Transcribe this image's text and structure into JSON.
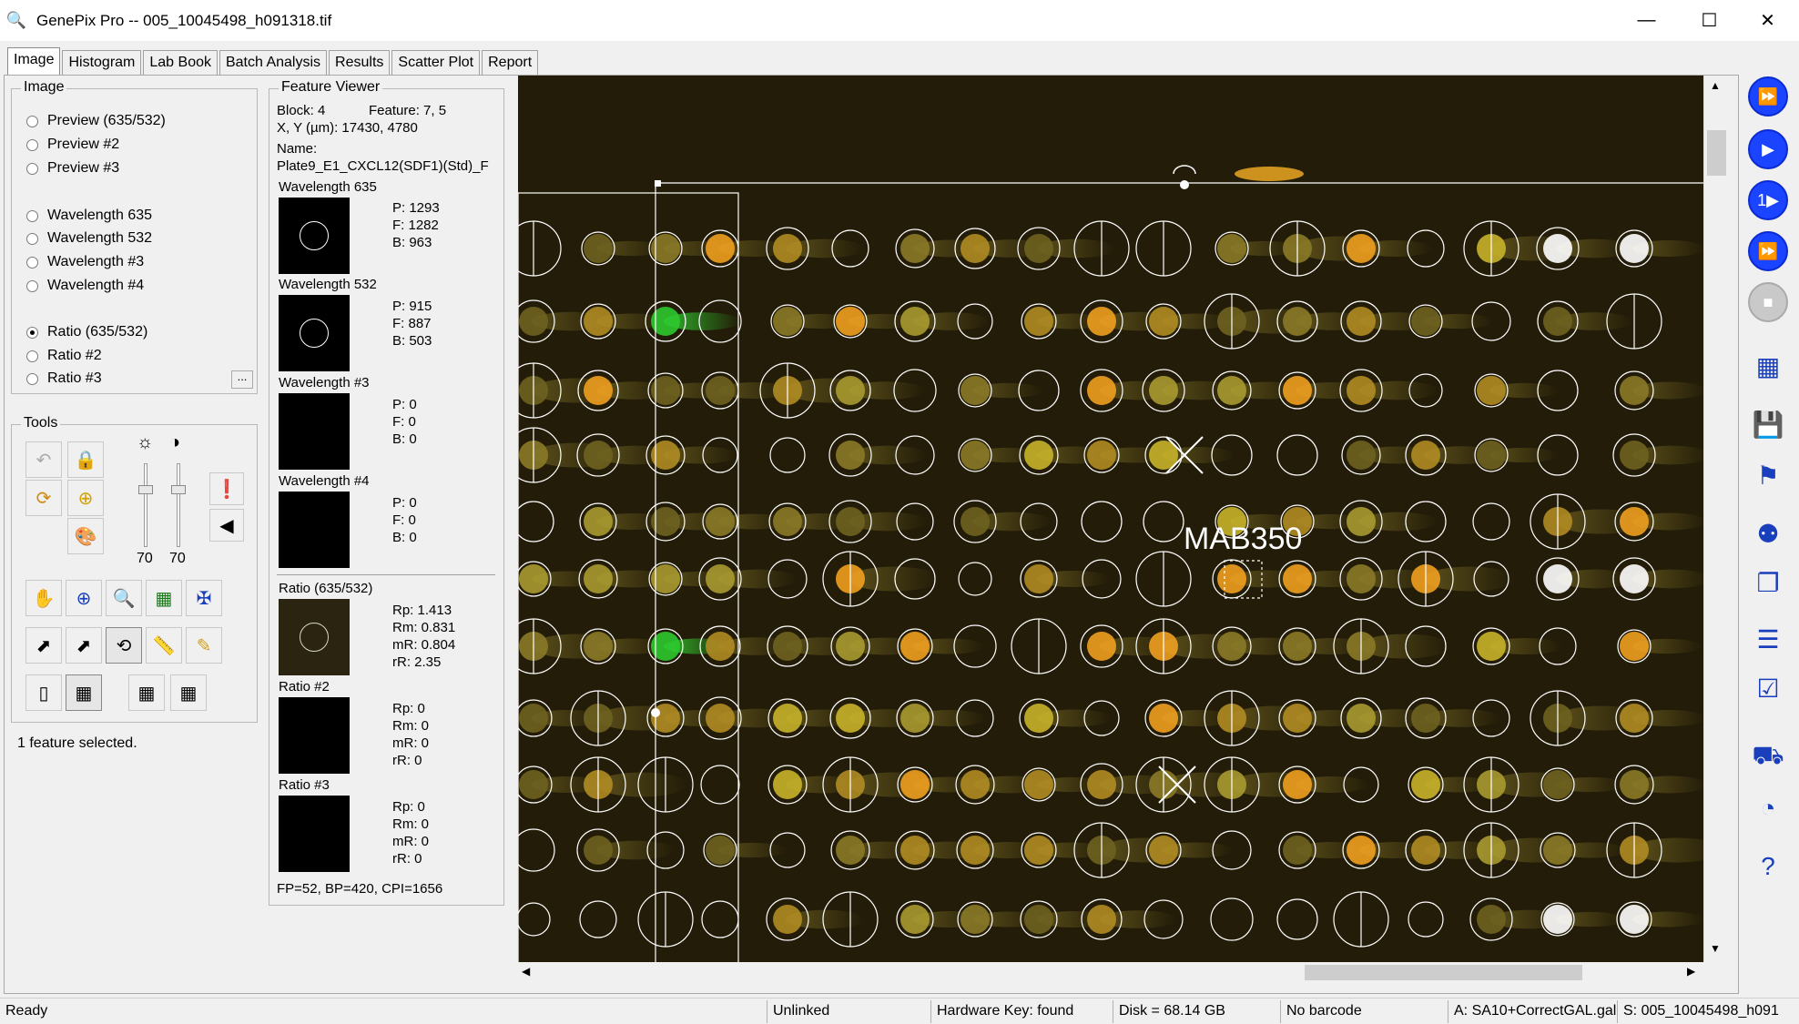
{
  "window": {
    "title": "GenePix Pro -- 005_10045498_h091318.tif",
    "app_icon": "magnifier-icon",
    "minimize_glyph": "—",
    "maximize_glyph": "☐",
    "close_glyph": "✕"
  },
  "tabs": [
    {
      "label": "Image",
      "active": true
    },
    {
      "label": "Histogram",
      "active": false
    },
    {
      "label": "Lab Book",
      "active": false
    },
    {
      "label": "Batch Analysis",
      "active": false
    },
    {
      "label": "Results",
      "active": false
    },
    {
      "label": "Scatter Plot",
      "active": false
    },
    {
      "label": "Report",
      "active": false
    }
  ],
  "image_group": {
    "title": "Image",
    "options": [
      {
        "label": "Preview (635/532)",
        "checked": false
      },
      {
        "label": "Preview #2",
        "checked": false
      },
      {
        "label": "Preview #3",
        "checked": false
      },
      {
        "label": "Wavelength 635",
        "checked": false
      },
      {
        "label": "Wavelength 532",
        "checked": false
      },
      {
        "label": "Wavelength #3",
        "checked": false
      },
      {
        "label": "Wavelength #4",
        "checked": false
      },
      {
        "label": "Ratio (635/532)",
        "checked": true
      },
      {
        "label": "Ratio #2",
        "checked": false
      },
      {
        "label": "Ratio #3",
        "checked": false
      }
    ],
    "more_button": "..."
  },
  "tools_group": {
    "title": "Tools",
    "brightness_value": "70",
    "contrast_value": "70",
    "brightness_icon": "☼",
    "contrast_icon": "◑",
    "selection_status": "1 feature selected."
  },
  "feature_viewer": {
    "title": "Feature Viewer",
    "block_label": "Block: 4",
    "feature_label": "Feature:  7, 5",
    "xy_label": "X, Y (µm): 17430, 4780",
    "name_label": "Name:",
    "name_value": "Plate9_E1_CXCL12(SDF1)(Std)_F",
    "wavelengths": [
      {
        "title": "Wavelength 635",
        "P": "P:    1293",
        "F": "F:    1282",
        "B": "B:    963",
        "ring": true
      },
      {
        "title": "Wavelength 532",
        "P": "P:    915",
        "F": "F:    887",
        "B": "B:    503",
        "ring": true
      },
      {
        "title": "Wavelength #3",
        "P": "P:    0",
        "F": "F:    0",
        "B": "B:    0",
        "ring": false
      },
      {
        "title": "Wavelength #4",
        "P": "P:    0",
        "F": "F:    0",
        "B": "B:    0",
        "ring": false
      }
    ],
    "ratios": [
      {
        "title": "Ratio (635/532)",
        "Rp": "Rp:   1.413",
        "Rm": "Rm:  0.831",
        "mR": "mR:  0.804",
        "rR": "rR:   2.35",
        "ring": true
      },
      {
        "title": "Ratio #2",
        "Rp": "Rp:   0",
        "Rm": "Rm:  0",
        "mR": "mR:  0",
        "rR": "rR:   0",
        "ring": false
      },
      {
        "title": "Ratio #3",
        "Rp": "Rp:   0",
        "Rm": "Rm:  0",
        "mR": "mR:  0",
        "rR": "rR:   0",
        "ring": false
      }
    ],
    "footer": "FP=52, BP=420, CPI=1656"
  },
  "image_pane": {
    "annotation_label": "MAB350",
    "colors": {
      "background": "#231c08",
      "grid_line": "#ffffff",
      "spot_yellow": "#c8b22a",
      "spot_orange": "#f0a020",
      "spot_green": "#2ec82e"
    }
  },
  "status_bar": {
    "ready": "Ready",
    "link": "Unlinked",
    "hardware_key": "Hardware Key: found",
    "disk": "Disk = 68.14 GB",
    "barcode": "No barcode",
    "gal": "A: SA10+CorrectGAL.gal",
    "scan": "S: 005_10045498_h091"
  },
  "right_toolbar": [
    {
      "name": "fast-scan-icon",
      "glyph": "⏩"
    },
    {
      "name": "scan-icon",
      "glyph": "▶"
    },
    {
      "name": "line-scan-icon",
      "glyph": "1▶"
    },
    {
      "name": "multi-scan-icon",
      "glyph": "⏩"
    },
    {
      "name": "stop-icon",
      "glyph": "■"
    },
    {
      "name": "block-grid-icon",
      "glyph": "▦"
    },
    {
      "name": "save-open-icon",
      "glyph": "💾"
    },
    {
      "name": "flag-tool-icon",
      "glyph": "⚑"
    },
    {
      "name": "find-binoculars-icon",
      "glyph": "⚉"
    },
    {
      "name": "copy-icon",
      "glyph": "❐"
    },
    {
      "name": "layers-icon",
      "glyph": "☰"
    },
    {
      "name": "options-toggle-icon",
      "glyph": "☑"
    },
    {
      "name": "hardware-icon",
      "glyph": "⛟"
    },
    {
      "name": "gauge-icon",
      "glyph": "◔"
    },
    {
      "name": "help-book-icon",
      "glyph": "?"
    }
  ]
}
